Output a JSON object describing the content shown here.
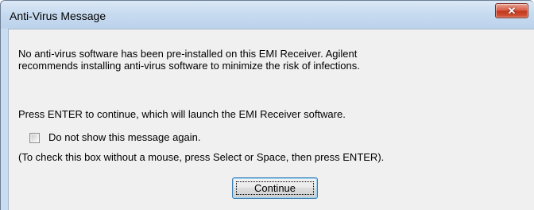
{
  "window": {
    "title": "Anti-Virus Message",
    "close_glyph": "✕"
  },
  "message": {
    "line1": "No anti-virus software has been pre-installed on this EMI Receiver.  Agilent",
    "line2": "recommends installing anti-virus software to minimize the risk of infections.",
    "instruction": "Press ENTER to continue, which will launch the EMI Receiver software."
  },
  "checkbox": {
    "label": "Do not show this message again.",
    "checked": false,
    "hint": "(To check this box without a mouse, press Select or Space, then press ENTER)."
  },
  "buttons": {
    "continue_label": "Continue"
  }
}
